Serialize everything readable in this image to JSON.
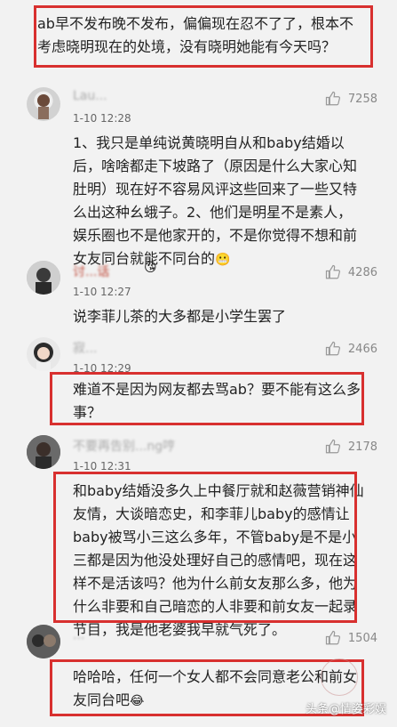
{
  "top_comment": {
    "text": "ab早不发布晚不发布，偏偏现在忍不了了，根本不考虑晓明现在的处境，没有晓明她能有今天吗？"
  },
  "comments": [
    {
      "name": "Lau...",
      "time": "1-10 12:28",
      "likes": "7258",
      "text": "1、我只是单纯说黄晓明自从和baby结婚以后，啥啥都走下坡路了（原因是什么大家心知肚明）现在好不容易风评这些回来了一些又特么出这种幺蛾子。2、他们是明星不是素人，娱乐圈也不是他家开的，不是你觉得不想和前女友同台就能不同台的"
    },
    {
      "name": "讨...话",
      "time": "1-10 12:27",
      "likes": "4286",
      "text": "说李菲儿茶的大多都是小学生罢了"
    },
    {
      "name": "寂...",
      "time": "1-10 12:29",
      "likes": "2466",
      "text": "难道不是因为网友都去骂ab？要不能有这么多事？"
    },
    {
      "name": "不要再告别...ng哼",
      "time": "1-10 12:31",
      "likes": "2178",
      "text": "和baby结婚没多久上中餐厅就和赵薇营销神仙友情，大谈暗恋史，和李菲儿baby的感情让baby被骂小三这么多年，不管baby是不是小三都是因为他没处理好自己的感情吧，现在这样不是活该吗？他为什么前女友那么多，他为什么非要和自己暗恋的人非要和前女友一起录节目，我是他老婆我早就气死了。"
    },
    {
      "name": "...",
      "time": "",
      "likes": "1504",
      "text": "哈哈哈，任何一个女人都不会同意老公和前女友同台吧"
    }
  ],
  "watermark": "头条@情姿彩娱",
  "colors": {
    "highlight_border": "#d8302f",
    "background": "#f2f2f2"
  },
  "icons": {
    "like": "thumbs-up-icon"
  }
}
